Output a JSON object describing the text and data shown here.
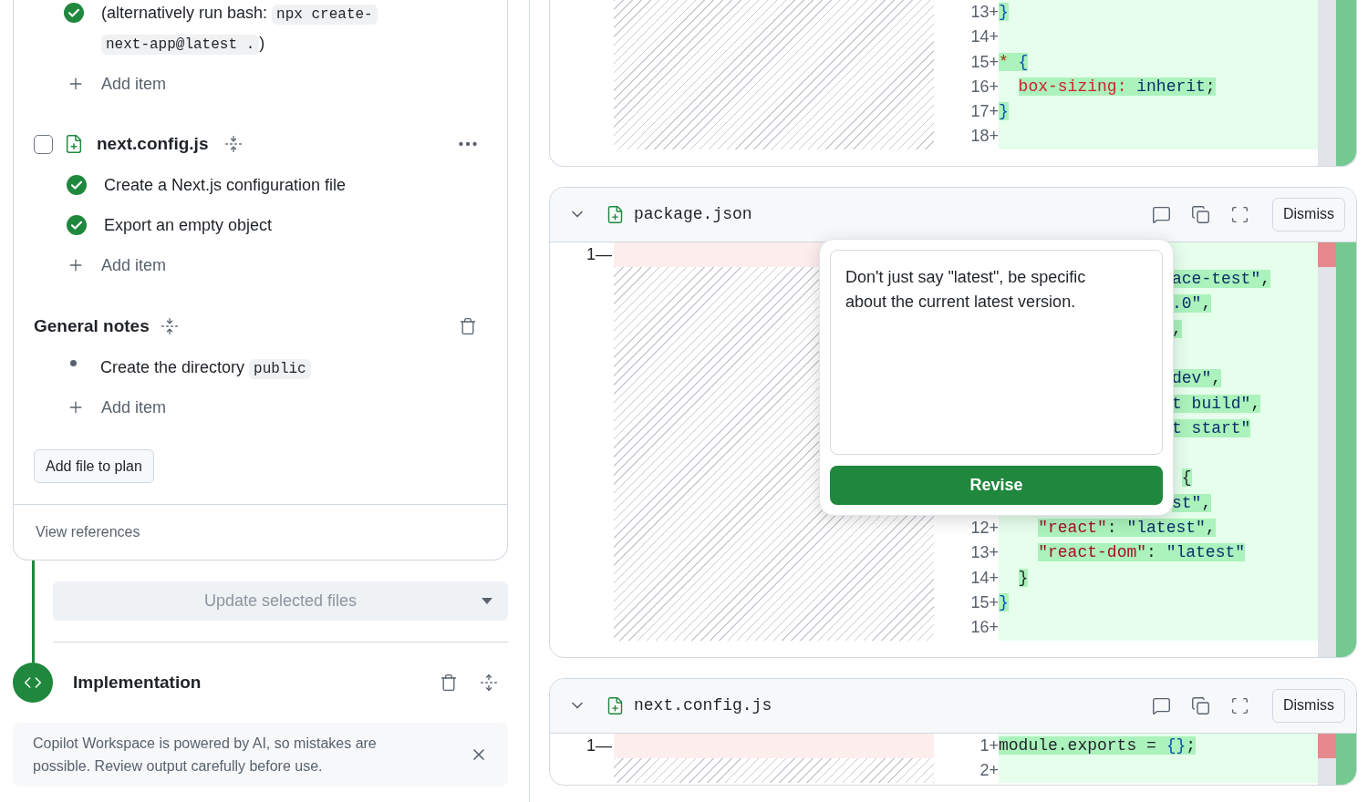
{
  "plan": {
    "top_item": {
      "checked": true,
      "segments": [
        {
          "kind": "text",
          "text": "(alternatively run bash: "
        },
        {
          "kind": "code",
          "text": "npx create-next-app@latest ."
        },
        {
          "kind": "text",
          "text": ")"
        }
      ]
    },
    "top_add_item": "Add item",
    "file": {
      "name": "next.config.js",
      "checked": false,
      "items": [
        {
          "text": "Create a Next.js configuration file",
          "checked": true
        },
        {
          "text": "Export an empty object",
          "checked": true
        }
      ],
      "add_item": "Add item"
    },
    "general_notes": {
      "title": "General notes",
      "items": [
        {
          "segments": [
            {
              "kind": "text",
              "text": "Create the directory "
            },
            {
              "kind": "code",
              "text": "public"
            }
          ]
        }
      ],
      "add_item": "Add item"
    },
    "add_file_button": "Add file to plan",
    "view_references": "View references"
  },
  "update_button": {
    "label": "Update selected files",
    "disabled": true
  },
  "implementation": {
    "title": "Implementation"
  },
  "notice": {
    "text": "Copilot Workspace is powered by AI, so mistakes are possible. Review output carefully before use."
  },
  "diffs": [
    {
      "right": [
        {
          "kind": "added",
          "gutter": "13+",
          "tokens": [
            {
              "kind": "brace",
              "text": "}"
            }
          ]
        },
        {
          "kind": "added",
          "gutter": "14+"
        },
        {
          "kind": "added",
          "gutter": "15+",
          "tokens": [
            {
              "kind": "selector",
              "text": "*"
            },
            {
              "kind": "brace",
              "text": " {"
            }
          ]
        },
        {
          "kind": "added",
          "gutter": "16+",
          "tokens": [
            {
              "kind": "property",
              "text": "  box-sizing:"
            },
            {
              "kind": "value",
              "text": " inherit"
            },
            {
              "kind": "punct",
              "text": ";"
            }
          ]
        },
        {
          "kind": "added",
          "gutter": "17+",
          "tokens": [
            {
              "kind": "brace",
              "text": "}"
            }
          ]
        },
        {
          "kind": "added",
          "gutter": "18+"
        }
      ]
    },
    {
      "name": "package.json",
      "dismiss": "Dismiss",
      "left": [
        {
          "gutter": "1—"
        }
      ],
      "right": [
        {
          "kind": "added"
        },
        {
          "kind": "added",
          "tokens": [
            {
              "kind": "string",
              "text": "ace-test\""
            },
            {
              "kind": "punct",
              "text": ","
            }
          ]
        },
        {
          "kind": "added",
          "tokens": [
            {
              "kind": "string",
              "text": ".0\""
            },
            {
              "kind": "punct",
              "text": ","
            }
          ]
        },
        {
          "kind": "added",
          "tokens": [
            {
              "kind": "punct",
              "text": ","
            }
          ]
        },
        {
          "kind": "added"
        },
        {
          "kind": "added",
          "tokens": [
            {
              "kind": "string",
              "text": "dev\""
            },
            {
              "kind": "punct",
              "text": ","
            }
          ]
        },
        {
          "kind": "added",
          "tokens": [
            {
              "kind": "string",
              "text": "t build\""
            },
            {
              "kind": "punct",
              "text": ","
            }
          ]
        },
        {
          "kind": "added",
          "tokens": [
            {
              "kind": "string",
              "text": "t start\""
            }
          ]
        },
        {
          "kind": "added"
        },
        {
          "kind": "added",
          "tokens": [
            {
              "kind": "punct",
              "text": " {"
            }
          ]
        },
        {
          "kind": "added",
          "tokens": [
            {
              "kind": "string",
              "text": "st\""
            },
            {
              "kind": "punct",
              "text": ","
            }
          ]
        },
        {
          "kind": "added",
          "gutter": "12+",
          "tokens": [
            {
              "kind": "key",
              "text": "    \"react\""
            },
            {
              "kind": "punct",
              "text": ": "
            },
            {
              "kind": "string",
              "text": "\"latest\""
            },
            {
              "kind": "punct",
              "text": ","
            }
          ]
        },
        {
          "kind": "added",
          "gutter": "13+",
          "tokens": [
            {
              "kind": "key",
              "text": "    \"react-dom\""
            },
            {
              "kind": "punct",
              "text": ": "
            },
            {
              "kind": "string",
              "text": "\"latest\""
            }
          ]
        },
        {
          "kind": "added",
          "gutter": "14+",
          "tokens": [
            {
              "kind": "punct",
              "text": "  }"
            }
          ]
        },
        {
          "kind": "added",
          "gutter": "15+",
          "tokens": [
            {
              "kind": "brace",
              "text": "}"
            }
          ]
        },
        {
          "kind": "added",
          "gutter": "16+"
        }
      ],
      "comment": {
        "value": "Don't just say \"latest\", be specific about the current latest version.",
        "button": "Revise"
      }
    },
    {
      "name": "next.config.js",
      "dismiss": "Dismiss",
      "left": [
        {
          "gutter": "1—"
        }
      ],
      "right": [
        {
          "kind": "added",
          "gutter": "1+",
          "tokens": [
            {
              "kind": "plain",
              "text": "module.exports = "
            },
            {
              "kind": "brace",
              "text": "{}"
            },
            {
              "kind": "punct",
              "text": ";"
            }
          ]
        },
        {
          "kind": "added",
          "gutter": "2+"
        }
      ]
    }
  ]
}
